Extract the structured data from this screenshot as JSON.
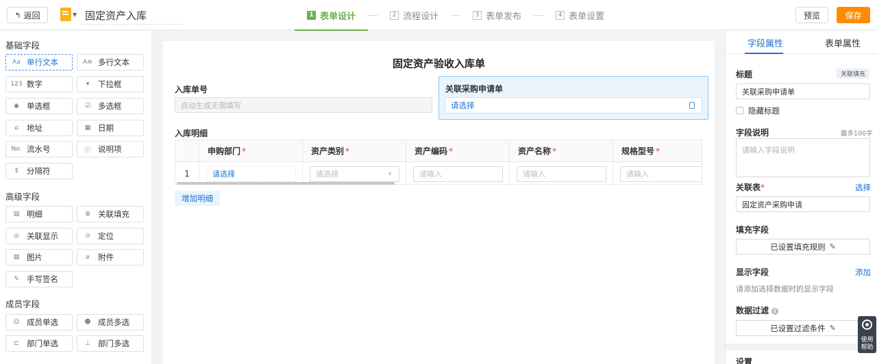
{
  "header": {
    "back_label": "返回",
    "app_title": "固定资产入库",
    "steps": [
      {
        "num": "1",
        "label": "表单设计"
      },
      {
        "num": "2",
        "label": "流程设计"
      },
      {
        "num": "3",
        "label": "表单发布"
      },
      {
        "num": "4",
        "label": "表单设置"
      }
    ],
    "preview_label": "预览",
    "save_label": "保存"
  },
  "left_panel": {
    "basic_title": "基础字段",
    "basic": [
      {
        "icon": "text-line-icon",
        "glyph": "Aa",
        "label": "单行文本"
      },
      {
        "icon": "text-multi-icon",
        "glyph": "A≡",
        "label": "多行文本"
      },
      {
        "icon": "number-icon",
        "glyph": "123",
        "label": "数字"
      },
      {
        "icon": "dropdown-icon",
        "glyph": "▾",
        "label": "下拉框"
      },
      {
        "icon": "radio-icon",
        "glyph": "◉",
        "label": "单选框"
      },
      {
        "icon": "checkbox-icon",
        "glyph": "☑",
        "label": "多选框"
      },
      {
        "icon": "address-icon",
        "glyph": "⌂",
        "label": "地址"
      },
      {
        "icon": "calendar-icon",
        "glyph": "▦",
        "label": "日期"
      },
      {
        "icon": "serial-number-icon",
        "glyph": "No.",
        "label": "流水号"
      },
      {
        "icon": "info-icon",
        "glyph": "ⓘ",
        "label": "说明项"
      },
      {
        "icon": "divider-icon",
        "glyph": "⇕",
        "label": "分隔符"
      }
    ],
    "advanced_title": "高级字段",
    "advanced": [
      {
        "icon": "detail-table-icon",
        "glyph": "▤",
        "label": "明细"
      },
      {
        "icon": "database-icon",
        "glyph": "≣",
        "label": "关联填充"
      },
      {
        "icon": "eye-icon",
        "glyph": "◎",
        "label": "关联显示"
      },
      {
        "icon": "location-pin-icon",
        "glyph": "⊙",
        "label": "定位"
      },
      {
        "icon": "image-icon",
        "glyph": "▨",
        "label": "图片"
      },
      {
        "icon": "paperclip-icon",
        "glyph": "⌀",
        "label": "附件"
      },
      {
        "icon": "signature-pen-icon",
        "glyph": "✎",
        "label": "手写签名"
      }
    ],
    "member_title": "成员字段",
    "member": [
      {
        "icon": "user-icon",
        "glyph": "☺",
        "label": "成员单选"
      },
      {
        "icon": "users-icon",
        "glyph": "☻",
        "label": "成员多选"
      },
      {
        "icon": "department-icon",
        "glyph": "⊏",
        "label": "部门单选"
      },
      {
        "icon": "org-chart-icon",
        "glyph": "⊥",
        "label": "部门多选"
      }
    ]
  },
  "form": {
    "title": "固定资产验收入库单",
    "field_no_label": "入库单号",
    "field_no_placeholder": "自动生成无需填写",
    "related_label": "关联采购申请单",
    "related_placeholder": "请选择",
    "detail_label": "入库明细",
    "columns": [
      "申购部门",
      "资产类别",
      "资产编码",
      "资产名称",
      "规格型号"
    ],
    "row_number": "1",
    "row_cells": [
      "请选择",
      "请选择",
      "请输入",
      "请输入",
      "请输入"
    ],
    "add_row_label": "增加明细"
  },
  "right_panel": {
    "tab_field": "字段属性",
    "tab_form": "表单属性",
    "title_label": "标题",
    "title_tag": "关联填充",
    "title_value": "关联采购申请单",
    "hide_title_label": "隐藏标题",
    "desc_label": "字段说明",
    "desc_limit": "最多100字",
    "desc_placeholder": "请输入字段说明",
    "rel_table_label": "关联表",
    "rel_table_select": "选择",
    "rel_table_value": "固定资产采购申请",
    "fill_label": "填充字段",
    "fill_button": "已设置填充规则",
    "display_label": "显示字段",
    "display_add": "添加",
    "display_hint": "请添加选择数据时的显示字段",
    "filter_label": "数据过滤",
    "filter_button": "已设置过滤条件",
    "settings_label": "设置"
  },
  "help": {
    "label": "使用帮助"
  },
  "colors": {
    "accent_blue": "#1f6fd1",
    "step_green": "#6ab04c",
    "save_orange": "#ff8c00"
  }
}
